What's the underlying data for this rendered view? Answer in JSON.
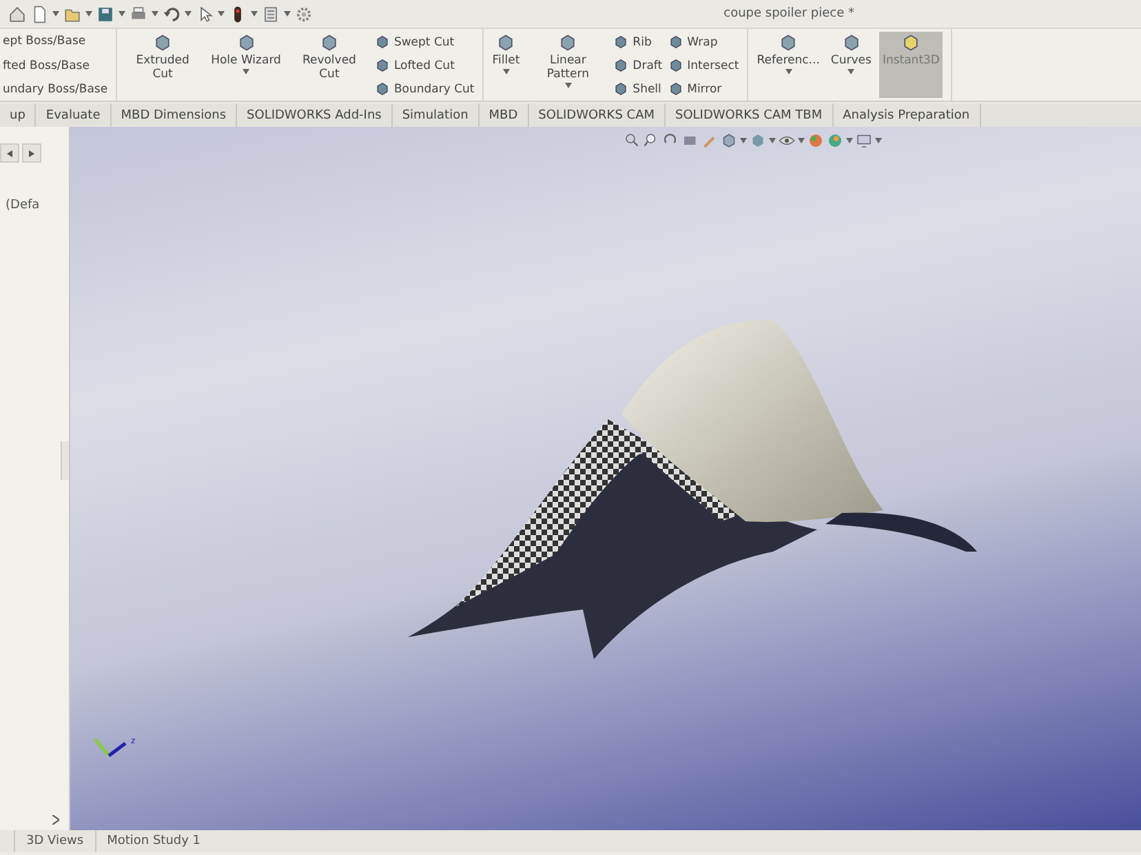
{
  "window": {
    "title": "coupe spoiler piece *"
  },
  "ribbon": {
    "groups": [
      {
        "columns": [
          {
            "kind": "stack",
            "items": [
              "ept Boss/Base",
              "fted Boss/Base",
              "undary Boss/Base"
            ]
          }
        ]
      },
      {
        "columns": [
          {
            "kind": "large",
            "label": "Extruded Cut",
            "dropdown": false,
            "pressed": false
          },
          {
            "kind": "large",
            "label": "Hole Wizard",
            "dropdown": true,
            "pressed": false
          },
          {
            "kind": "large",
            "label": "Revolved Cut",
            "dropdown": false,
            "pressed": false
          },
          {
            "kind": "stack",
            "items": [
              "Swept Cut",
              "Lofted Cut",
              "Boundary Cut"
            ]
          }
        ]
      },
      {
        "columns": [
          {
            "kind": "large",
            "label": "Fillet",
            "dropdown": true,
            "pressed": false
          },
          {
            "kind": "large",
            "label": "Linear Pattern",
            "dropdown": true,
            "pressed": false
          },
          {
            "kind": "stack",
            "items": [
              "Rib",
              "Draft",
              "Shell"
            ]
          },
          {
            "kind": "stack",
            "items": [
              "Wrap",
              "Intersect",
              "Mirror"
            ]
          }
        ]
      },
      {
        "columns": [
          {
            "kind": "large",
            "label": "Referenc...",
            "dropdown": true,
            "pressed": false
          },
          {
            "kind": "large",
            "label": "Curves",
            "dropdown": true,
            "pressed": false
          },
          {
            "kind": "large",
            "label": "Instant3D",
            "dropdown": false,
            "pressed": true
          }
        ]
      }
    ]
  },
  "tabs": [
    {
      "label": "up",
      "selected": false
    },
    {
      "label": "Evaluate",
      "selected": false
    },
    {
      "label": "MBD Dimensions",
      "selected": false
    },
    {
      "label": "SOLIDWORKS Add-Ins",
      "selected": false
    },
    {
      "label": "Simulation",
      "selected": false
    },
    {
      "label": "MBD",
      "selected": false
    },
    {
      "label": "SOLIDWORKS CAM",
      "selected": false
    },
    {
      "label": "SOLIDWORKS CAM TBM",
      "selected": false
    },
    {
      "label": "Analysis Preparation",
      "selected": false
    }
  ],
  "left_panel": {
    "item": "(Defa"
  },
  "viewport": {
    "triad_label": "z"
  },
  "bottom_tabs": [
    {
      "label": "3D Views",
      "selected": false
    },
    {
      "label": "Motion Study 1",
      "selected": false
    }
  ]
}
